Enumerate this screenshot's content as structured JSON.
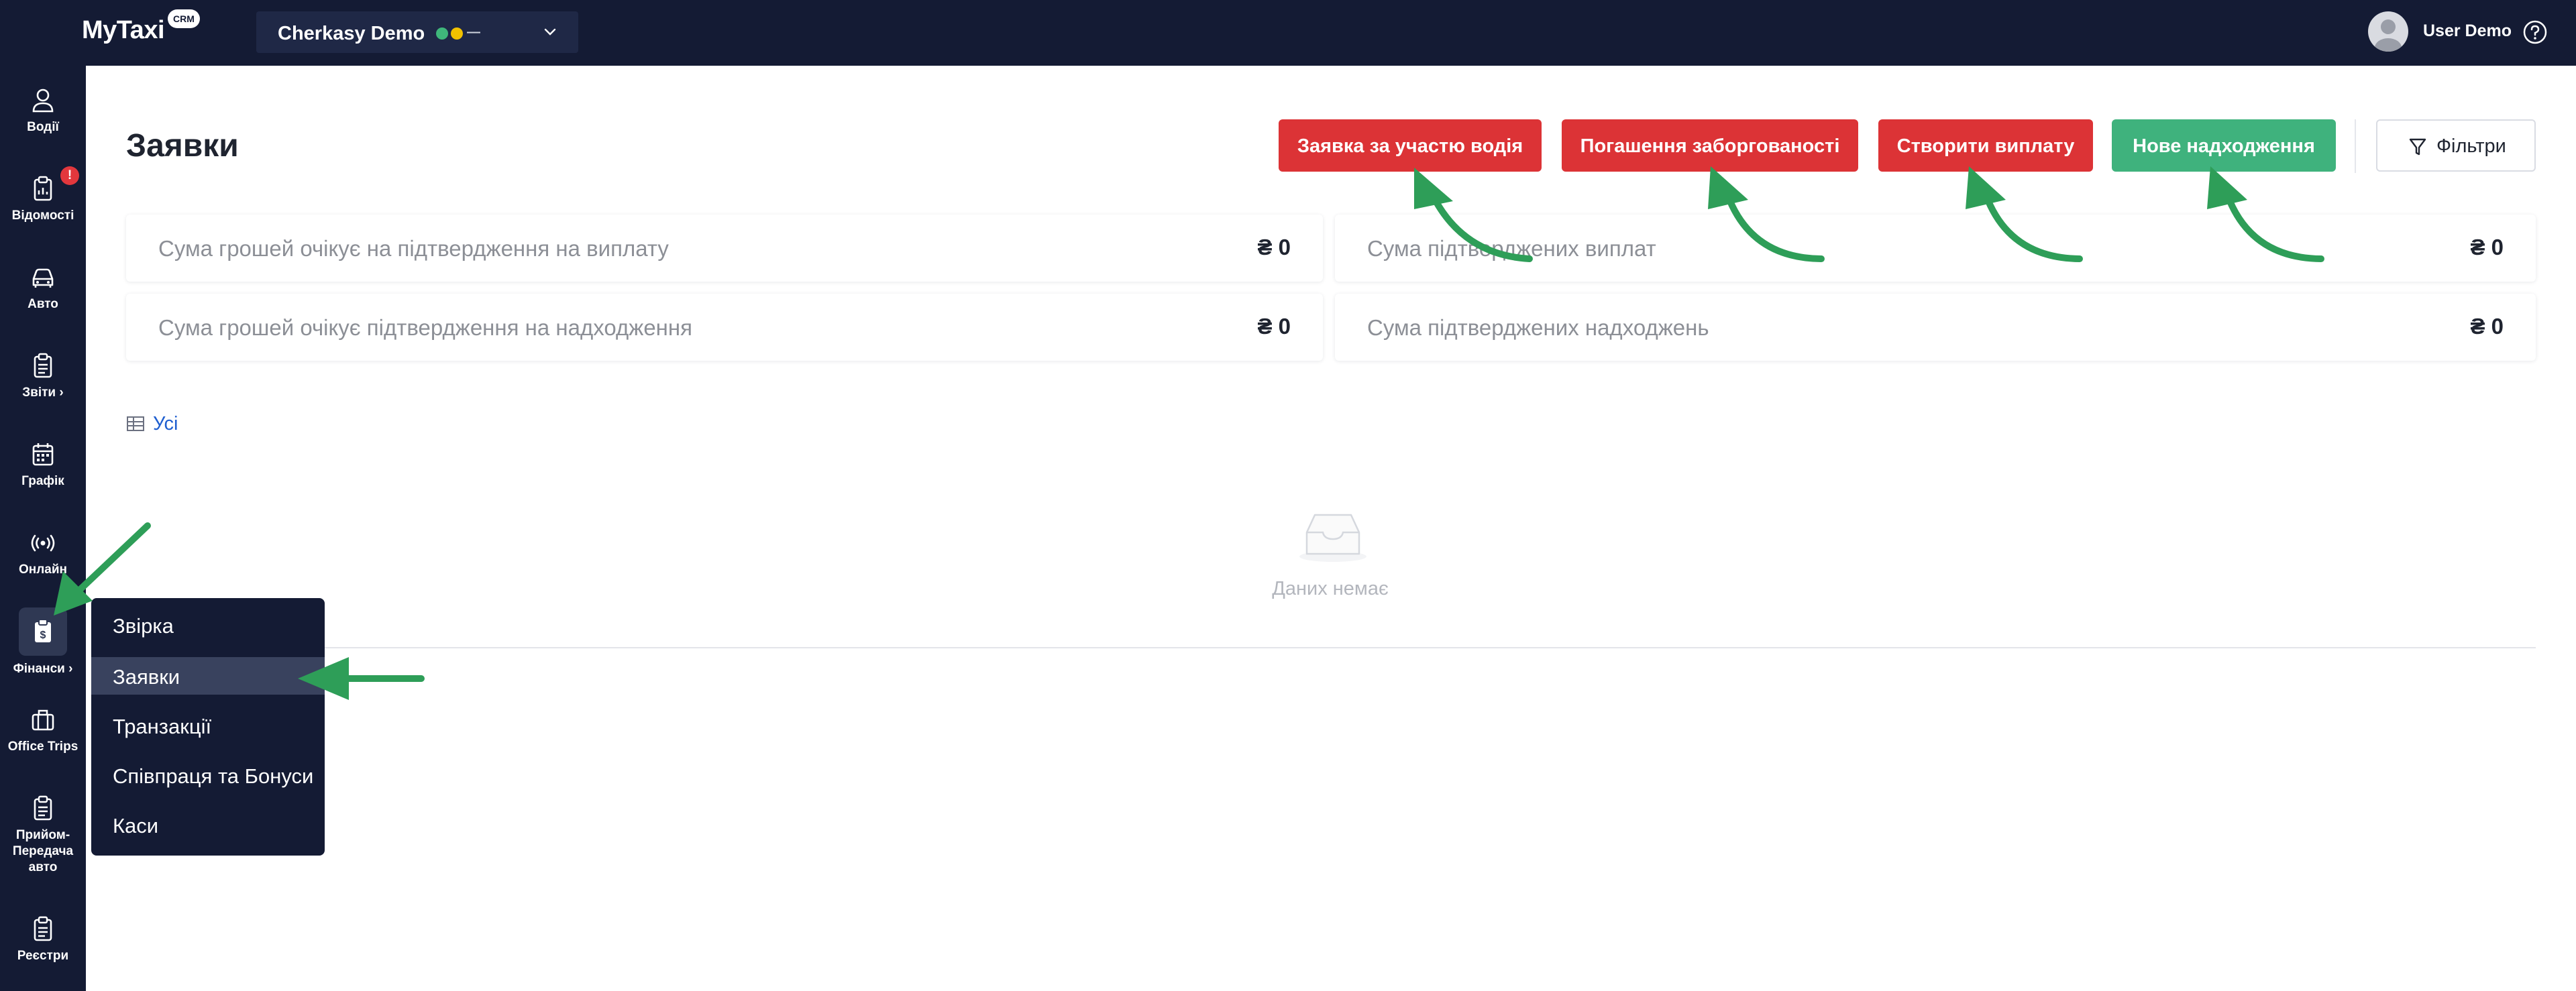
{
  "app": {
    "logo": "MyTaxi",
    "logo_badge": "CRM"
  },
  "company_selector": {
    "name": "Cherkasy Demo",
    "status_dash": "—"
  },
  "user": {
    "name": "User Demo"
  },
  "sidebar": {
    "items": [
      {
        "label": "Водії",
        "icon": "person-icon"
      },
      {
        "label": "Відомості",
        "icon": "report-icon",
        "badge": "!"
      },
      {
        "label": "Авто",
        "icon": "car-icon"
      },
      {
        "label": "Звіти ›",
        "icon": "clipboard-icon"
      },
      {
        "label": "Графік",
        "icon": "calendar-icon"
      },
      {
        "label": "Онлайн",
        "icon": "online-icon"
      },
      {
        "label": "Фінанси ›",
        "icon": "finance-icon"
      },
      {
        "label": "Office Trips",
        "icon": "briefcase-icon"
      },
      {
        "label": "Прийом-Передача авто",
        "icon": "clipboard-icon"
      },
      {
        "label": "Реєстри",
        "icon": "clipboard-icon"
      }
    ]
  },
  "main": {
    "title": "Заявки",
    "buttons": {
      "driver_request": "Заявка за участю водія",
      "debt_repayment": "Погашення заборгованості",
      "create_payout": "Створити виплату",
      "new_income": "Нове надходження",
      "filters": "Фільтри"
    },
    "stats": [
      {
        "label": "Сума грошей очікує на підтвердження на виплату",
        "value": "₴ 0"
      },
      {
        "label": "Сума підтверджених виплат",
        "value": "₴ 0"
      },
      {
        "label": "Сума грошей очікує підтвердження на надходження",
        "value": "₴ 0"
      },
      {
        "label": "Сума підтверджених надходжень",
        "value": "₴ 0"
      }
    ],
    "view_all": "Усі",
    "empty_text": "Даних немає"
  },
  "finance_submenu": {
    "items": [
      "Звірка",
      "Заявки",
      "Транзакції",
      "Співпраця та Бонуси",
      "Каси"
    ],
    "active": "Заявки"
  },
  "colors": {
    "sidebar": "#141b34",
    "red": "#dc3336",
    "green": "#3fb27d",
    "annotation_arrow": "#2e9e58"
  }
}
